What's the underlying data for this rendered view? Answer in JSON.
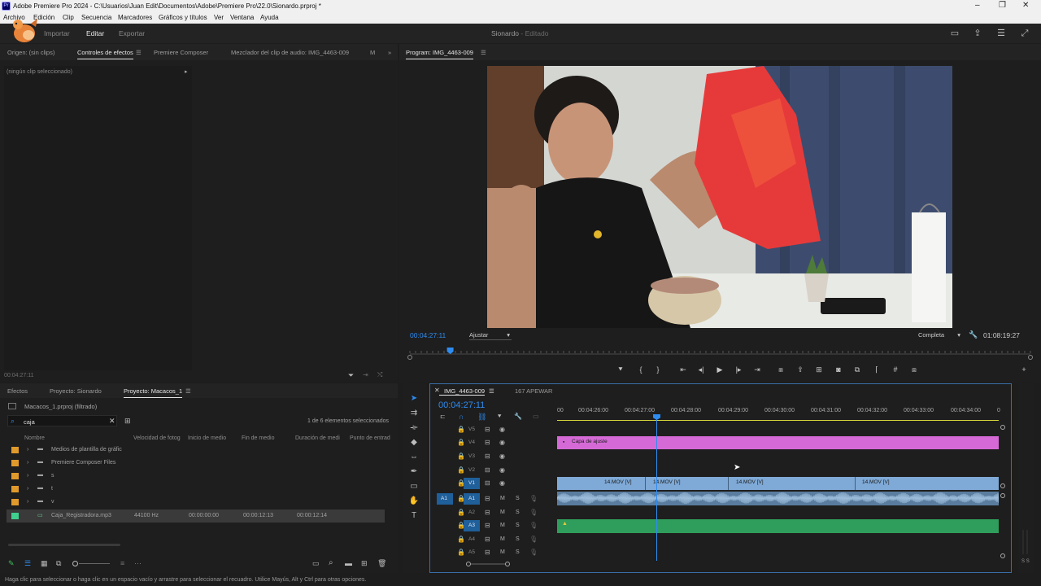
{
  "window": {
    "title": "Adobe Premiere Pro 2024 - C:\\Usuarios\\Juan Edit\\Documentos\\Adobe\\Premiere Pro\\22.0\\Sionardo.prproj *",
    "app_icon": "Pr"
  },
  "menu": [
    "Archivo",
    "Edición",
    "Clip",
    "Secuencia",
    "Marcadores",
    "Gráficos y títulos",
    "Ver",
    "Ventana",
    "Ayuda"
  ],
  "header": {
    "tabs": [
      "Importar",
      "Editar",
      "Exportar"
    ],
    "active_tab": "Editar",
    "project_name": "Sionardo",
    "project_status": "- Editado"
  },
  "source_panel": {
    "tabs": [
      "Origen: (sin clips)",
      "Controles de efectos",
      "Premiere Composer",
      "Mezclador del clip de audio: IMG_4463-009",
      "M"
    ],
    "no_clip": "(ningún clip seleccionado)",
    "timecode": "00:04:27:11"
  },
  "program_monitor": {
    "title": "Program: IMG_4463-009",
    "timecode": "00:04:27:11",
    "fit": "Ajustar",
    "quality": "Completa",
    "duration": "01:08:19:27",
    "playhead_fraction": 0.065
  },
  "project_panel": {
    "tabs": [
      "Efectos",
      "Proyecto: Sionardo",
      "Proyecto: Macacos_1"
    ],
    "file": "Macacos_1.prproj (filtrado)",
    "search": "caja",
    "count": "1 de 6 elementos seleccionados",
    "columns": [
      "Nombre",
      "Velocidad de fotog",
      "Inicio de medio",
      "Fin de medio",
      "Duración de medi",
      "Punto de entrad"
    ],
    "folders": [
      "Medios de plantilla de gráfic",
      "Premiere Composer Files",
      "s",
      "t",
      "v"
    ],
    "file_item": {
      "name": "Caja_Registradora.mp3",
      "rate": "44100 Hz",
      "start": "00:00:00:00",
      "end": "00:00:12:13",
      "duration": "00:00:12:14"
    }
  },
  "timeline": {
    "tabs": [
      "IMG_4463-009",
      "167 APEWAR"
    ],
    "timecode": "00:04:27:11",
    "ruler": [
      "00",
      "00:04:26:00",
      "00:04:27:00",
      "00:04:28:00",
      "00:04:29:00",
      "00:04:30:00",
      "00:04:31:00",
      "00:04:32:00",
      "00:04:33:00",
      "00:04:34:00",
      "0"
    ],
    "video_tracks": [
      "V5",
      "V4",
      "V3",
      "V2",
      "V1"
    ],
    "audio_tracks": [
      "A1",
      "A2",
      "A3",
      "A4",
      "A5"
    ],
    "adjustment_clip": "Capa de ajuste",
    "v1_clips": [
      "14.MOV [V]",
      "14.MOV [V]",
      "14.MOV [V]",
      "14.MOV [V]"
    ],
    "mute": "M",
    "solo": "S"
  },
  "status_bar": "Haga clic para seleccionar o haga clic en un espacio vacío y arrastre para seleccionar el recuadro. Utilice Mayús, Alt y Ctrl para otras opciones.",
  "colors": {
    "accent": "#2e8cf0",
    "adjustment": "#d56ad6",
    "video_clip": "#7fa9d6",
    "audio_clip": "#2f9d5b"
  }
}
